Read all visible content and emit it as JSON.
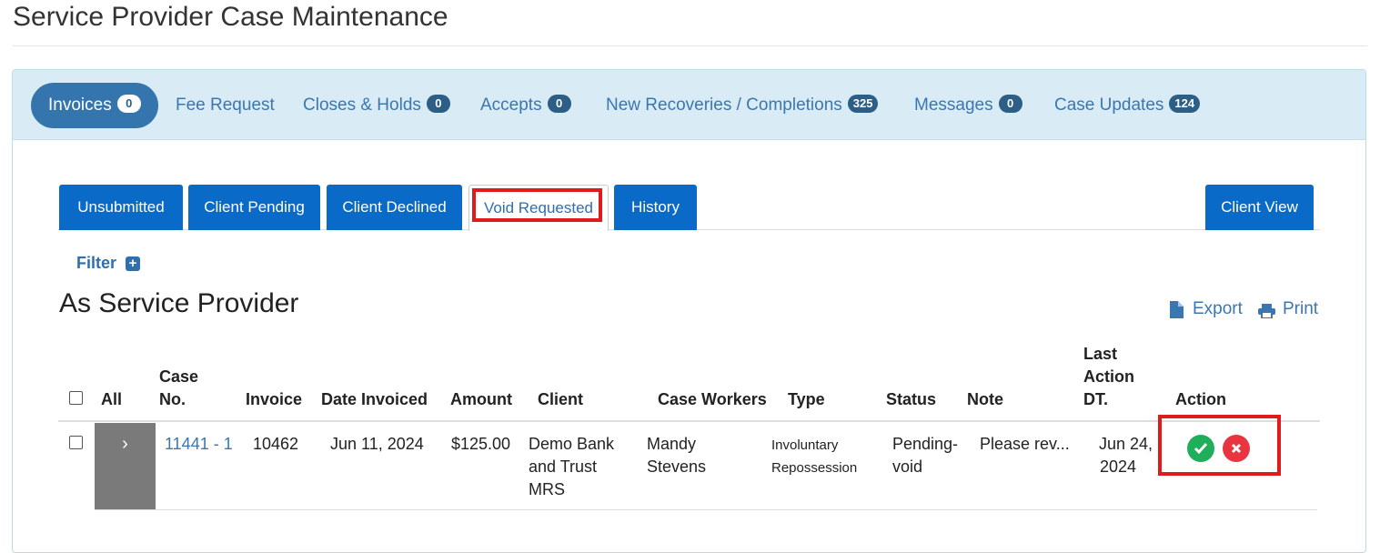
{
  "page": {
    "title": "Service Provider Case Maintenance"
  },
  "top_tabs": [
    {
      "label": "Invoices",
      "count": "0"
    },
    {
      "label": "Fee Request",
      "count": ""
    },
    {
      "label": "Closes & Holds",
      "count": "0"
    },
    {
      "label": "Accepts",
      "count": "0"
    },
    {
      "label": "New Recoveries / Completions",
      "count": "325"
    },
    {
      "label": "Messages",
      "count": "0"
    },
    {
      "label": "Case Updates",
      "count": "124"
    }
  ],
  "sub_tabs": [
    "Unsubmitted",
    "Client Pending",
    "Client Declined",
    "Void Requested",
    "History"
  ],
  "client_view_label": "Client View",
  "filter_label": "Filter",
  "section_title": "As Service Provider",
  "toolbar": {
    "export_label": "Export",
    "print_label": "Print"
  },
  "table": {
    "columns": {
      "all": "All",
      "case_no_1": "Case",
      "case_no_2": "No.",
      "invoice": "Invoice",
      "date_invoiced": "Date Invoiced",
      "amount": "Amount",
      "client": "Client",
      "case_workers": "Case Workers",
      "type": "Type",
      "status": "Status",
      "note": "Note",
      "last_1": "Last",
      "last_2": "Action",
      "last_3": "DT.",
      "action": "Action"
    },
    "rows": [
      {
        "case_no": "11441 - 1",
        "invoice": "10462",
        "date_invoiced": "Jun 11, 2024",
        "amount": "$125.00",
        "client_1": "Demo Bank",
        "client_2": "and Trust",
        "client_3": "MRS",
        "worker_1": "Mandy",
        "worker_2": "Stevens",
        "type_1": "Involuntary",
        "type_2": "Repossession",
        "status_1": "Pending-",
        "status_2": "void",
        "note": "Please rev...",
        "last_1": "Jun 24,",
        "last_2": "2024"
      }
    ]
  },
  "colors": {
    "accent": "#3575ae",
    "tab_blue": "#0a6ac7",
    "approve": "#1fae5a",
    "reject": "#e8353f",
    "highlight": "#e01b1b"
  }
}
